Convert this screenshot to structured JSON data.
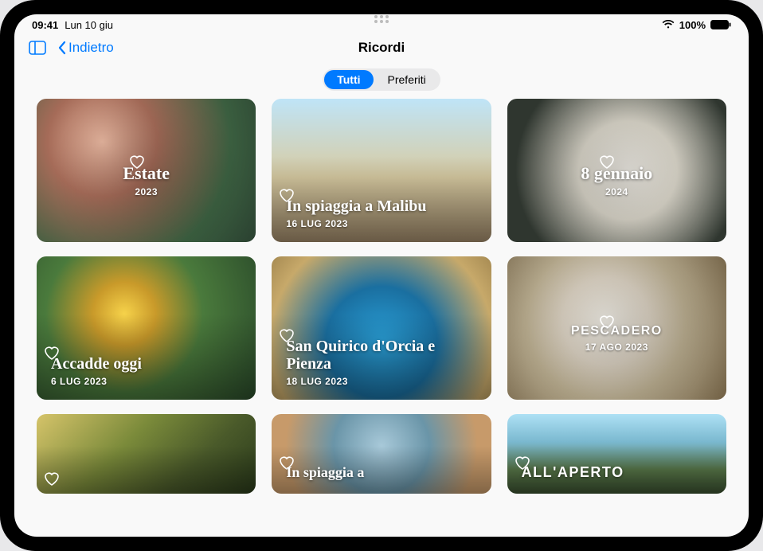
{
  "status": {
    "time": "09:41",
    "date": "Lun 10 giu",
    "battery_pct": "100%"
  },
  "nav": {
    "back_label": "Indietro",
    "title": "Ricordi"
  },
  "segments": {
    "all": "Tutti",
    "favorites": "Preferiti",
    "active": "all"
  },
  "memories": [
    {
      "title": "Estate",
      "date": "2023",
      "align": "center",
      "title_style": "serif"
    },
    {
      "title": "In spiaggia a Malibu",
      "date": "16 LUG 2023",
      "align": "left",
      "title_style": "serif"
    },
    {
      "title": "8 gennaio",
      "date": "2024",
      "align": "center",
      "title_style": "serif"
    },
    {
      "title": "Accadde oggi",
      "date": "6 LUG 2023",
      "align": "left",
      "title_style": "serif"
    },
    {
      "title": "San Quirico d'Orcia e Pienza",
      "date": "18 LUG 2023",
      "align": "left",
      "title_style": "serif"
    },
    {
      "title": "PESCADERO",
      "date": "17 AGO 2023",
      "align": "center",
      "title_style": "condensed"
    },
    {
      "title": "",
      "date": "",
      "align": "left",
      "title_style": "serif"
    },
    {
      "title": "In spiaggia a",
      "date": "",
      "align": "left",
      "title_style": "serif"
    },
    {
      "title": "ALL'APERTO",
      "date": "",
      "align": "left",
      "title_style": "condensed"
    }
  ]
}
